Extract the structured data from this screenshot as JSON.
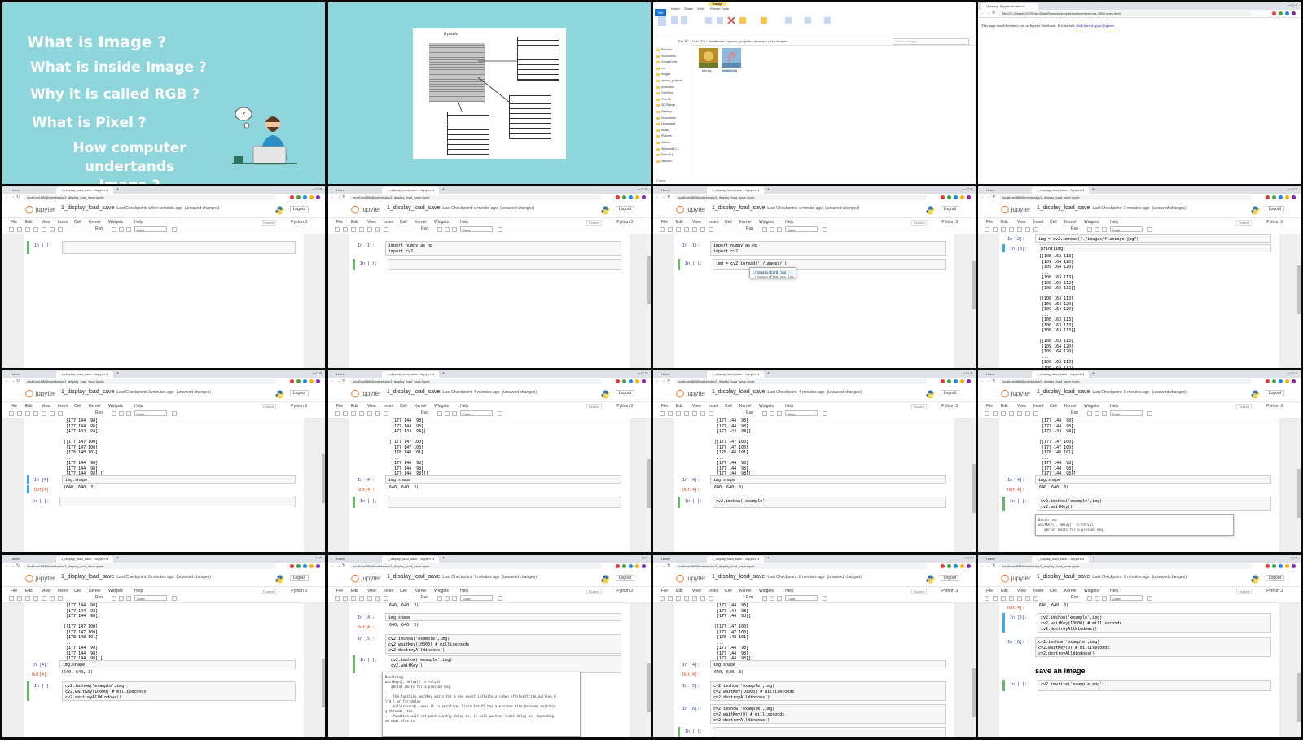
{
  "slide": {
    "lines": [
      "What is Image ?",
      "What is inside Image ?",
      "Why it is called RGB ?",
      "What is Pixel ?",
      "How computer undertands",
      "Image ?"
    ]
  },
  "diagram": {
    "px_label": "8 pixels"
  },
  "explorer": {
    "tabs": [
      "File",
      "Home",
      "Share",
      "View",
      "Picture Tools"
    ],
    "manage": "Manage",
    "breadcrumb": "This PC › Data (D:) › Shelfbooks › opencv_projects › develop › ch1 › images",
    "search_placeholder": "Search images",
    "nav_items": [
      "Pictures",
      "Documents",
      "GoogleDrive",
      "ch1",
      "images",
      "opencv_projects",
      "production",
      "OneDrive",
      "This PC",
      "3D Objects",
      "Desktop",
      "Documents",
      "Downloads",
      "Music",
      "Pictures",
      "Videos",
      "Windows (C:)",
      "Data (D:)",
      "Network"
    ],
    "files": [
      "bird.jpg",
      "flamingo.jpg"
    ],
    "status": "2 items"
  },
  "redirect_page": {
    "tab": "Opening Jupyter Notebook",
    "url": "file:///C:/Users/USER/AppData/Roaming/jupyter/runtime/nbserver-3308-open.html",
    "text": "This page should redirect you to Jupyter Notebook. If it doesn't,",
    "link": "click here to go to Jupyter."
  },
  "browser": {
    "home_tab": "Home",
    "nb_tab": "1_display_load_save - Jupyter N",
    "url": "localhost:8888/notebooks/1_display_load_save.ipynb"
  },
  "jupyter": {
    "logo": "jupyter",
    "notebook_name": "1_display_load_save",
    "logout": "Logout",
    "trusted": "Trusted",
    "kernel": "Python 3",
    "menu": [
      "File",
      "Edit",
      "View",
      "Insert",
      "Cell",
      "Kernel",
      "Widgets",
      "Help"
    ],
    "run": "Run",
    "celltype": "Code"
  },
  "checkpoints": [
    "Last Checkpoint: a few seconds ago",
    "Last Checkpoint: a minute ago",
    "Last Checkpoint: a minute ago",
    "Last Checkpoint: 2 minutes ago",
    "Last Checkpoint: 3 minutes ago",
    "Last Checkpoint: 4 minutes ago",
    "Last Checkpoint: 4 minutes ago",
    "Last Checkpoint: 5 minutes ago",
    "Last Checkpoint: 6 minutes ago",
    "Last Checkpoint: 7 minutes ago",
    "Last Checkpoint: 8 minutes ago",
    "Last Checkpoint: 8 minutes ago"
  ],
  "unsaved": "(unsaved changes)",
  "code": {
    "in_empty": "In [ ]:",
    "in1": "In [1]:",
    "in2": "In [2]:",
    "in3": "In [3]:",
    "in4": "In [4]:",
    "in5": "In [5]:",
    "in6": "In [6]:",
    "out4": "Out[4]:",
    "imports": "import numpy as np\nimport cv2",
    "imread_partial": "img = cv2.imread('./images/')",
    "imread": "img = cv2.imread(\"./images/flamingo.jpg\")",
    "autocomplete": [
      "./images/bird.jpg",
      "./images/flamingo.jpg"
    ],
    "print": "print(img)",
    "array_top": "[[[108 163 113]\n  [109 164 120]\n  [109 164 120]\n  ...\n  [108 163 113]\n  [108 163 113]\n  [108 163 113]]\n\n [[108 163 113]\n  [109 164 120]\n  [109 164 120]\n  ...\n  [108 163 113]\n  [108 163 113]\n  [108 163 113]]\n\n [[108 163 113]\n  [109 164 120]\n  [109 164 120]\n  ...\n  [108 163 113]\n  [108 163 113]",
    "array_bottom": "  [177 144  98]\n  [177 144  98]\n  [177 144  98]]\n\n [[177 147 100]\n  [177 147 100]\n  [178 148 101]\n  ...\n  [177 144  98]\n  [177 144  98]\n  [177 144  98]]]",
    "shape": "img.shape",
    "shape_out": "(640, 640, 3)",
    "imshow_partial": "cv2.imshow('example')",
    "imshow_waitkey": "cv2.imshow('example',img)\ncv2.waitKey()",
    "imshow_full": "cv2.imshow('example',img)\ncv2.waitKey(10000) # milliseconds\ncv2.destroyAllWindows()",
    "imshow_zero": "cv2.imshow('example',img)\ncv2.waitKey(0) # milliseconds\ncv2.destroyAllWindows()",
    "docstring_short": "Docstring:\nwaitKey([, delay]) -> retval\n   @brief Waits for a pressed key.",
    "docstring_long": "Docstring:\nwaitKey([, delay]) -> retval\n   @brief Waits for a pressed key.\n.\n.   The function waitKey waits for a key event infinitely (when \\f$\\texttt{delay}\\leq 0\n\\f$ ) or for delay\n.   milliseconds, when it is positive. Since the OS has a minimum time between switchin\ng threads, the\n.   function will not wait exactly delay ms, it will wait at least delay ms, depending\non what else is",
    "save_heading": "save an image",
    "imwrite": "cv2.imwrite('example.png')"
  },
  "colors": {
    "slide_bg": "#8ed6dc",
    "jupyter_orange": "#f37726",
    "cell_select": "#42a5f5",
    "cell_edit": "#66bb6a"
  }
}
